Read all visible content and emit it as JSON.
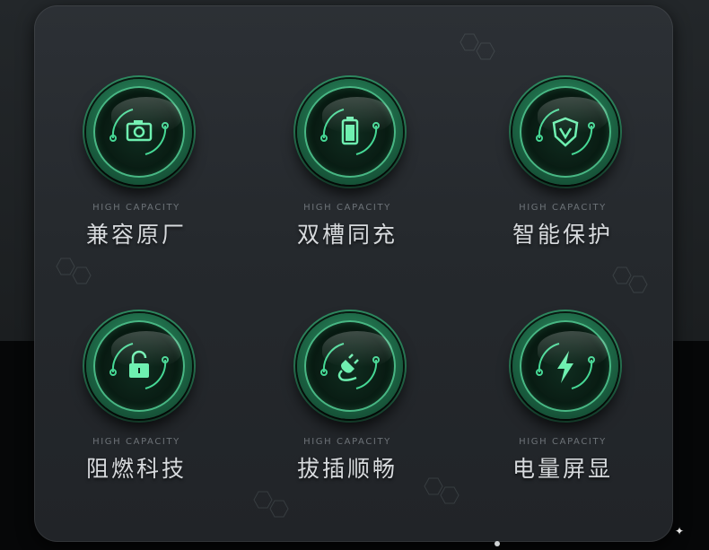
{
  "colors": {
    "accent": "#3fbf86",
    "icon_glow": "#46d895",
    "panel": "#2a2e32"
  },
  "features": [
    {
      "small": "HIGH CAPACITY",
      "title": "兼容原厂",
      "icon": "camera-icon"
    },
    {
      "small": "HIGH CAPACITY",
      "title": "双槽同充",
      "icon": "battery-icon"
    },
    {
      "small": "HIGH CAPACITY",
      "title": "智能保护",
      "icon": "shield-icon"
    },
    {
      "small": "HIGH CAPACITY",
      "title": "阻燃科技",
      "icon": "unlock-icon"
    },
    {
      "small": "HIGH CAPACITY",
      "title": "拔插顺畅",
      "icon": "plug-icon"
    },
    {
      "small": "HIGH CAPACITY",
      "title": "电量屏显",
      "icon": "lightning-icon"
    }
  ]
}
